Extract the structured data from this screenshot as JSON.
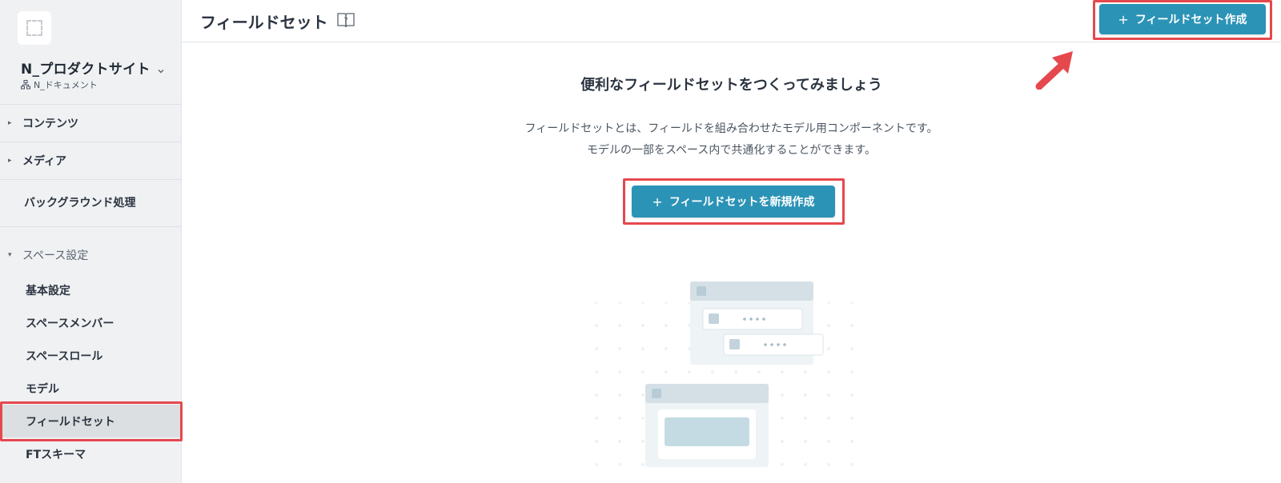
{
  "sidebar": {
    "space_name": "N_プロダクトサイト",
    "org_name": "N_ドキュメント",
    "nav": [
      {
        "label": "コンテンツ"
      },
      {
        "label": "メディア"
      },
      {
        "label": "バックグラウンド処理"
      }
    ],
    "section_label": "スペース設定",
    "sub_items": [
      {
        "label": "基本設定"
      },
      {
        "label": "スペースメンバー"
      },
      {
        "label": "スペースロール"
      },
      {
        "label": "モデル"
      },
      {
        "label": "フィールドセット",
        "active": true
      },
      {
        "label": "FTスキーマ"
      }
    ]
  },
  "header": {
    "title": "フィールドセット",
    "create_button_label": "フィールドセット作成"
  },
  "main": {
    "headline": "便利なフィールドセットをつくってみましょう",
    "description_line1": "フィールドセットとは、フィールドを組み合わせたモデル用コンポーネントです。",
    "description_line2": "モデルの一部をスペース内で共通化することができます。",
    "create_button_label": "フィールドセットを新規作成"
  },
  "colors": {
    "primary": "#2b93b6",
    "highlight": "#e5484d",
    "sidebar_bg": "#f0f1f3"
  },
  "icons": {
    "plus": "+",
    "help": "book-question-icon",
    "org": "org-tree-icon",
    "chevron": "chevron-down-icon",
    "caret_right": "▸",
    "caret_down": "▾"
  }
}
